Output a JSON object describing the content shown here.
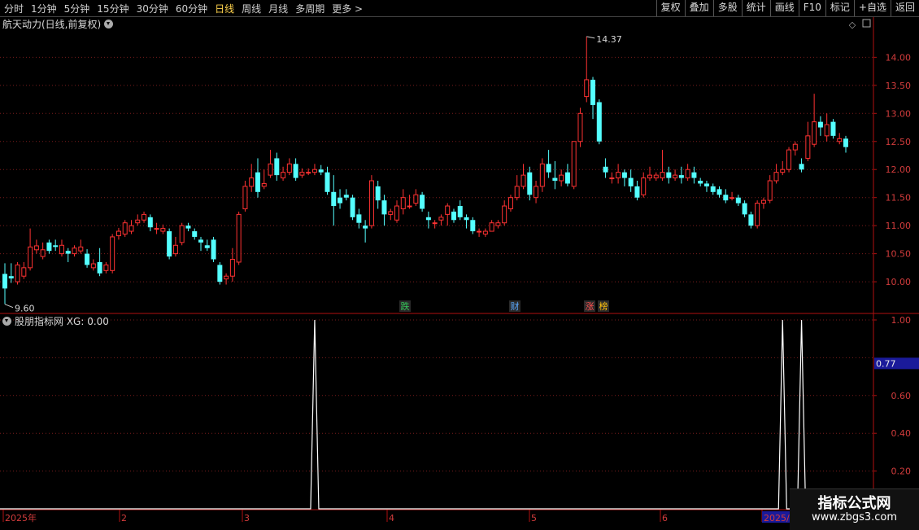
{
  "toolbar": {
    "left": [
      "分时",
      "1分钟",
      "5分钟",
      "15分钟",
      "30分钟",
      "60分钟",
      "日线",
      "周线",
      "月线",
      "多周期",
      "更多 >"
    ],
    "active": "日线",
    "right": [
      "复权",
      "叠加",
      "多股",
      "统计",
      "画线",
      "F10",
      "标记",
      "+自选",
      "返回"
    ]
  },
  "main_title": "航天动力(日线,前复权)",
  "sub_title": "股朋指标网 XG: 0.00",
  "price_label_max": "14.37",
  "price_label_min": "9.60",
  "current_value_box": "0.77",
  "markers": [
    {
      "text": "跌",
      "color": "#34c759"
    },
    {
      "text": "财",
      "color": "#5aa9ff"
    },
    {
      "text": "涨",
      "color": "#ff5050"
    },
    {
      "text": "榜",
      "color": "#ffc20e"
    }
  ],
  "watermark": {
    "line1": "指标公式网",
    "line2": "www.zbgs3.com"
  },
  "colors": {
    "up": "#ff3232",
    "down": "#54ffff",
    "grid": "#7a1c1c",
    "axis": "#b01010"
  },
  "chart_data": {
    "type": "candlestick",
    "y_ticks": [
      "14.00",
      "13.50",
      "13.00",
      "12.50",
      "12.00",
      "11.50",
      "11.00",
      "10.50",
      "10.00"
    ],
    "ylim": [
      9.45,
      14.6
    ],
    "indicator_ticks": [
      "1.00",
      "0.60",
      "0.40",
      "0.20"
    ],
    "indicator_ylim": [
      0,
      1.0
    ],
    "x_labels": [
      "2025年",
      "2",
      "3",
      "4",
      "5",
      "6",
      "2025/0"
    ],
    "candles": [
      [
        10.14,
        9.88,
        10.33,
        9.6
      ],
      [
        10.1,
        10.06,
        10.33,
        9.98
      ],
      [
        10.0,
        10.3,
        10.35,
        9.95
      ],
      [
        10.1,
        10.25,
        10.35,
        10.05
      ],
      [
        10.25,
        10.62,
        10.95,
        10.2
      ],
      [
        10.57,
        10.64,
        10.75,
        10.5
      ],
      [
        10.45,
        10.57,
        10.7,
        10.4
      ],
      [
        10.7,
        10.55,
        10.75,
        10.5
      ],
      [
        10.65,
        10.62,
        10.75,
        10.55
      ],
      [
        10.5,
        10.65,
        10.75,
        10.45
      ],
      [
        10.55,
        10.5,
        10.6,
        10.35
      ],
      [
        10.5,
        10.6,
        10.65,
        10.45
      ],
      [
        10.55,
        10.62,
        10.75,
        10.5
      ],
      [
        10.5,
        10.3,
        10.58,
        10.25
      ],
      [
        10.25,
        10.32,
        10.4,
        10.2
      ],
      [
        10.35,
        10.15,
        10.6,
        10.1
      ],
      [
        10.2,
        10.3,
        10.35,
        10.15
      ],
      [
        10.2,
        10.8,
        10.85,
        10.15
      ],
      [
        10.82,
        10.9,
        10.96,
        10.75
      ],
      [
        10.85,
        11.05,
        11.1,
        10.8
      ],
      [
        10.9,
        11.0,
        11.1,
        10.85
      ],
      [
        11.05,
        11.1,
        11.2,
        11.0
      ],
      [
        11.1,
        11.2,
        11.25,
        11.05
      ],
      [
        11.15,
        10.97,
        11.2,
        10.9
      ],
      [
        10.95,
        10.95,
        11.05,
        10.85
      ],
      [
        10.9,
        10.95,
        11.02,
        10.85
      ],
      [
        10.9,
        10.45,
        10.95,
        10.4
      ],
      [
        10.5,
        10.65,
        10.8,
        10.45
      ],
      [
        10.7,
        11.0,
        11.05,
        10.65
      ],
      [
        11.0,
        10.95,
        11.05,
        10.9
      ],
      [
        10.9,
        10.8,
        10.95,
        10.75
      ],
      [
        10.75,
        10.7,
        10.8,
        10.55
      ],
      [
        10.65,
        10.6,
        10.75,
        10.55
      ],
      [
        10.75,
        10.4,
        10.8,
        10.35
      ],
      [
        10.3,
        10.0,
        10.35,
        9.95
      ],
      [
        10.05,
        10.1,
        10.15,
        9.95
      ],
      [
        10.1,
        10.4,
        10.6,
        10.0
      ],
      [
        10.35,
        11.2,
        11.25,
        10.3
      ],
      [
        11.3,
        11.7,
        11.8,
        11.25
      ],
      [
        11.7,
        11.85,
        12.1,
        11.6
      ],
      [
        11.95,
        11.6,
        12.2,
        11.5
      ],
      [
        11.7,
        11.75,
        12.0,
        11.65
      ],
      [
        11.9,
        12.1,
        12.35,
        11.85
      ],
      [
        12.2,
        11.9,
        12.3,
        11.8
      ],
      [
        11.85,
        11.95,
        12.05,
        11.8
      ],
      [
        11.95,
        12.1,
        12.2,
        11.9
      ],
      [
        12.1,
        11.85,
        12.2,
        11.8
      ],
      [
        11.9,
        11.95,
        12.02,
        11.85
      ],
      [
        11.95,
        11.95,
        12.02,
        11.9
      ],
      [
        11.95,
        12.0,
        12.1,
        11.9
      ],
      [
        12.0,
        11.95,
        12.08,
        11.9
      ],
      [
        11.95,
        11.6,
        12.05,
        11.55
      ],
      [
        11.6,
        11.35,
        11.9,
        11.0
      ],
      [
        11.5,
        11.4,
        11.65,
        11.3
      ],
      [
        11.55,
        11.5,
        11.65,
        11.45
      ],
      [
        11.5,
        11.15,
        11.55,
        11.1
      ],
      [
        11.2,
        11.05,
        11.3,
        10.95
      ],
      [
        11.0,
        10.95,
        11.1,
        10.7
      ],
      [
        11.0,
        11.8,
        11.9,
        10.95
      ],
      [
        11.7,
        11.45,
        11.8,
        11.3
      ],
      [
        11.45,
        11.2,
        11.55,
        11.0
      ],
      [
        11.2,
        11.25,
        11.3,
        11.1
      ],
      [
        11.1,
        11.35,
        11.45,
        11.05
      ],
      [
        11.3,
        11.5,
        11.65,
        11.2
      ],
      [
        11.35,
        11.35,
        11.55,
        11.3
      ],
      [
        11.4,
        11.55,
        11.65,
        11.35
      ],
      [
        11.55,
        11.3,
        11.6,
        11.25
      ],
      [
        11.15,
        11.1,
        11.25,
        10.95
      ],
      [
        11.05,
        11.05,
        11.1,
        10.95
      ],
      [
        11.1,
        11.15,
        11.2,
        11.0
      ],
      [
        11.2,
        11.35,
        11.4,
        11.0
      ],
      [
        11.25,
        11.1,
        11.3,
        11.05
      ],
      [
        11.35,
        11.15,
        11.45,
        11.1
      ],
      [
        11.15,
        11.1,
        11.2,
        10.95
      ],
      [
        11.1,
        10.9,
        11.15,
        10.85
      ],
      [
        10.9,
        10.9,
        10.95,
        10.8
      ],
      [
        10.85,
        10.9,
        10.95,
        10.8
      ],
      [
        10.9,
        11.05,
        11.1,
        10.9
      ],
      [
        11.0,
        11.05,
        11.1,
        10.95
      ],
      [
        11.05,
        11.35,
        11.45,
        11.0
      ],
      [
        11.3,
        11.5,
        11.55,
        11.25
      ],
      [
        11.5,
        11.7,
        11.9,
        11.45
      ],
      [
        11.7,
        11.9,
        12.1,
        11.65
      ],
      [
        11.95,
        11.55,
        12.05,
        11.45
      ],
      [
        11.5,
        11.7,
        11.8,
        11.4
      ],
      [
        11.7,
        12.1,
        12.2,
        11.6
      ],
      [
        12.1,
        11.95,
        12.35,
        11.85
      ],
      [
        11.85,
        11.8,
        12.15,
        11.65
      ],
      [
        11.8,
        11.9,
        12.0,
        11.7
      ],
      [
        11.95,
        11.75,
        12.1,
        11.7
      ],
      [
        11.7,
        12.5,
        12.5,
        11.65
      ],
      [
        12.5,
        13.0,
        13.1,
        12.4
      ],
      [
        13.3,
        13.6,
        14.37,
        13.2
      ],
      [
        13.6,
        13.15,
        13.65,
        12.9
      ],
      [
        13.2,
        12.5,
        13.25,
        12.45
      ],
      [
        12.05,
        11.95,
        12.2,
        11.85
      ],
      [
        11.85,
        11.85,
        11.95,
        11.75
      ],
      [
        11.85,
        11.95,
        12.1,
        11.75
      ],
      [
        11.95,
        11.85,
        12.0,
        11.7
      ],
      [
        11.85,
        11.7,
        12.0,
        11.6
      ],
      [
        11.7,
        11.5,
        11.8,
        11.45
      ],
      [
        11.55,
        11.85,
        11.95,
        11.5
      ],
      [
        11.85,
        11.9,
        12.05,
        11.8
      ],
      [
        11.85,
        11.9,
        11.95,
        11.8
      ],
      [
        11.85,
        11.95,
        12.35,
        11.8
      ],
      [
        11.95,
        11.85,
        12.05,
        11.75
      ],
      [
        11.85,
        11.9,
        12.0,
        11.8
      ],
      [
        11.9,
        11.85,
        12.05,
        11.75
      ],
      [
        11.85,
        12.0,
        12.1,
        11.8
      ],
      [
        11.95,
        11.85,
        12.05,
        11.75
      ],
      [
        11.8,
        11.75,
        11.85,
        11.7
      ],
      [
        11.75,
        11.7,
        11.8,
        11.6
      ],
      [
        11.7,
        11.6,
        11.75,
        11.55
      ],
      [
        11.65,
        11.55,
        11.7,
        11.5
      ],
      [
        11.55,
        11.45,
        11.65,
        11.4
      ],
      [
        11.5,
        11.5,
        11.6,
        11.45
      ],
      [
        11.5,
        11.4,
        11.55,
        11.35
      ],
      [
        11.4,
        11.2,
        11.45,
        11.15
      ],
      [
        11.2,
        11.0,
        11.25,
        10.95
      ],
      [
        11.0,
        11.4,
        11.45,
        10.95
      ],
      [
        11.4,
        11.45,
        11.5,
        11.3
      ],
      [
        11.45,
        11.8,
        11.9,
        11.4
      ],
      [
        11.8,
        11.95,
        12.1,
        11.75
      ],
      [
        11.95,
        12.0,
        12.15,
        11.9
      ],
      [
        12.0,
        12.35,
        12.4,
        11.95
      ],
      [
        12.35,
        12.45,
        12.5,
        12.25
      ],
      [
        12.1,
        12.0,
        12.2,
        11.95
      ],
      [
        12.2,
        12.6,
        12.85,
        12.15
      ],
      [
        12.45,
        12.85,
        13.35,
        12.4
      ],
      [
        12.85,
        12.75,
        12.95,
        12.6
      ],
      [
        12.6,
        12.8,
        13.0,
        12.5
      ],
      [
        12.85,
        12.6,
        12.9,
        12.55
      ],
      [
        12.5,
        12.55,
        12.65,
        12.45
      ],
      [
        12.55,
        12.4,
        12.6,
        12.3
      ]
    ],
    "xg_spikes": [
      49,
      123,
      126
    ]
  }
}
